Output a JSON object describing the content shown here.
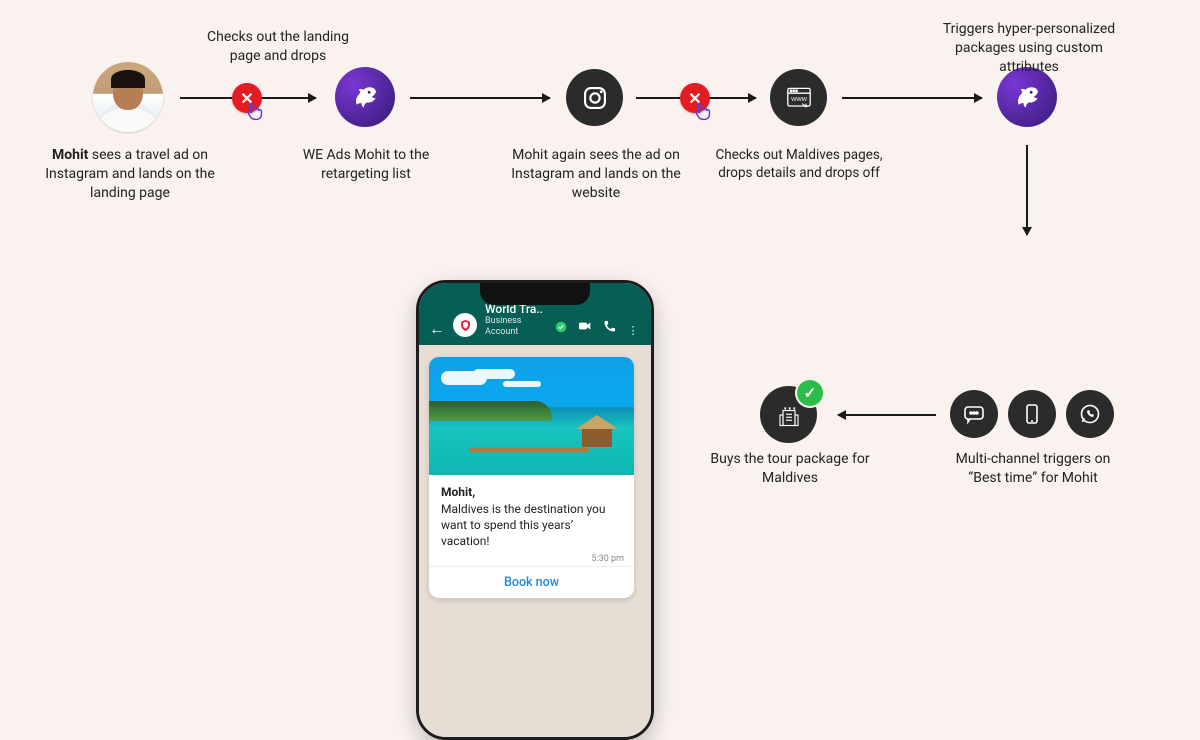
{
  "persona_name": "Mohit",
  "steps": {
    "s1_caption_html": "<b>Mohit</b> sees a travel ad on Instagram and lands on the landing page",
    "s1_above": "Checks out the landing page and drops",
    "s2_caption": "WE Ads Mohit to the retargeting list",
    "s3_caption": "Mohit again sees the ad on Instagram and lands on the website",
    "s4_caption": "Checks out Maldives pages, drops details and drops off",
    "s5_above": "Triggers hyper-personalized packages using custom attributes",
    "s6_caption": "Multi-channel triggers on “Best time” for Mohit",
    "s7_caption": "Buys the tour package for Maldives"
  },
  "phone": {
    "business_name": "World Tra..",
    "business_sub": "Business Account",
    "msg_name": "Mohit,",
    "msg_body": "Maldives is the destination you want to spend this years’ vacation!",
    "msg_time": "5:30 pm",
    "cta": "Book now"
  },
  "icons": {
    "instagram": "instagram",
    "browser": "browser-www",
    "hotel": "hotel-stars",
    "chat": "chat-bubble",
    "mobile": "mobile-device",
    "whatsapp": "whatsapp"
  },
  "colors": {
    "bg": "#f9f2ee",
    "dark": "#2b2b2b",
    "red": "#e31b23",
    "green": "#2dbd4b",
    "whatsapp_header": "#075e54",
    "link_blue": "#1e88e5"
  }
}
